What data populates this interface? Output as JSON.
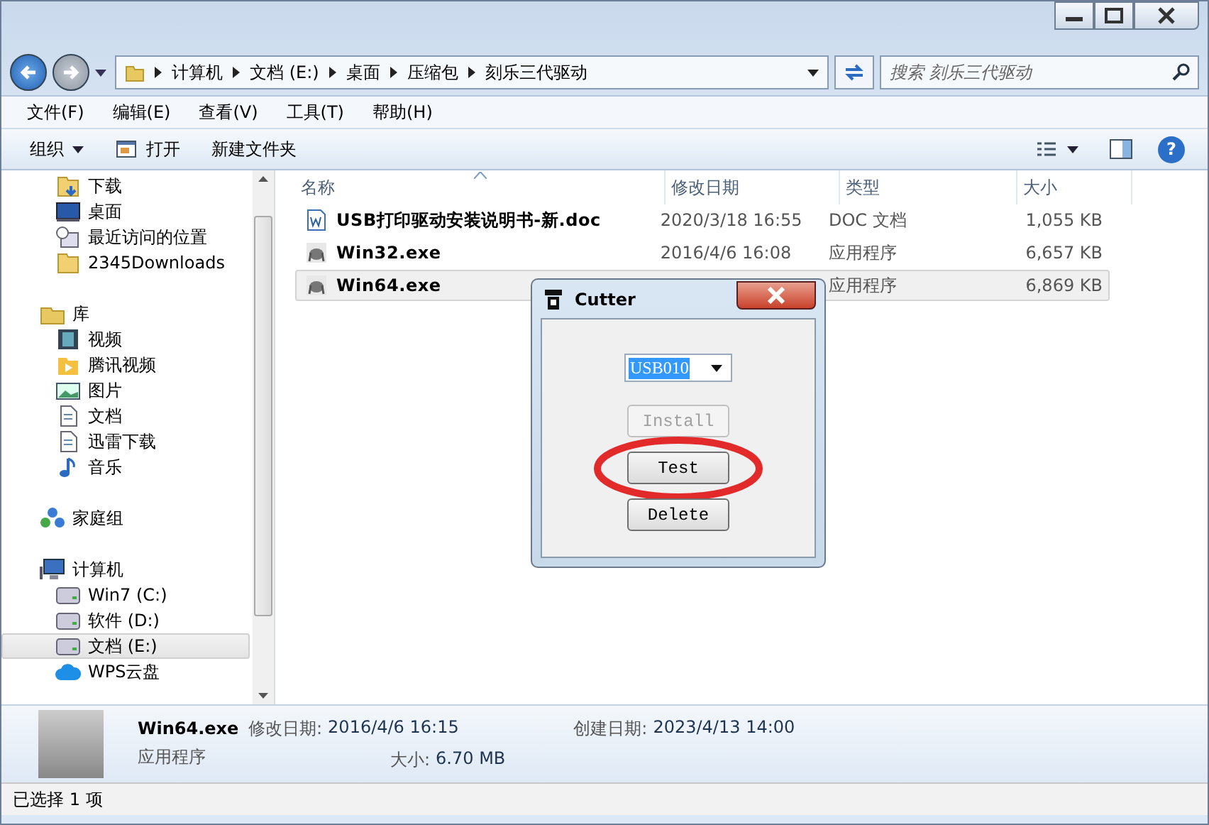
{
  "address_bar": {
    "crumbs": [
      "计算机",
      "文档 (E:)",
      "桌面",
      "压缩包",
      "刻乐三代驱动"
    ]
  },
  "search": {
    "placeholder": "搜索 刻乐三代驱动"
  },
  "menu_bar": [
    "文件(F)",
    "编辑(E)",
    "查看(V)",
    "工具(T)",
    "帮助(H)"
  ],
  "help_button": {
    "label": "?"
  },
  "toolbar": [
    {
      "label": "组织",
      "kind": "dropdown"
    },
    {
      "label": "打开",
      "kind": "open"
    },
    {
      "label": "新建文件夹",
      "kind": "plain"
    }
  ],
  "nav_pane": {
    "sections": [
      {
        "kind": "favorites",
        "children": [
          {
            "label": "下载",
            "kind": "download",
            "selected": false
          },
          {
            "label": "桌面",
            "kind": "desktop",
            "selected": false
          },
          {
            "label": "最近访问的位置",
            "kind": "recent",
            "selected": false
          },
          {
            "label": "2345Downloads",
            "kind": "folder",
            "selected": false
          }
        ]
      },
      {
        "label": "库",
        "kind": "library",
        "children": [
          {
            "label": "视频",
            "kind": "video",
            "selected": false
          },
          {
            "label": "腾讯视频",
            "kind": "player",
            "selected": false
          },
          {
            "label": "图片",
            "kind": "picture",
            "selected": false
          },
          {
            "label": "文档",
            "kind": "doc",
            "selected": false
          },
          {
            "label": "迅雷下载",
            "kind": "doc",
            "selected": false
          },
          {
            "label": "音乐",
            "kind": "music",
            "selected": false
          }
        ]
      },
      {
        "label": "家庭组",
        "kind": "homegroup"
      },
      {
        "label": "计算机",
        "kind": "computer",
        "children": [
          {
            "label": "Win7 (C:)",
            "kind": "drive",
            "selected": false
          },
          {
            "label": "软件 (D:)",
            "kind": "drive",
            "selected": false
          },
          {
            "label": "文档 (E:)",
            "kind": "drive",
            "selected": true
          },
          {
            "label": "WPS云盘",
            "kind": "cloud",
            "selected": false
          }
        ]
      }
    ]
  },
  "file_list": {
    "columns": [
      {
        "label": "名称",
        "sorted": true
      },
      {
        "label": "修改日期",
        "sorted": false
      },
      {
        "label": "类型",
        "sorted": false
      },
      {
        "label": "大小",
        "sorted": false
      }
    ],
    "rows": [
      {
        "name": "USB打印驱动安装说明书-新.doc",
        "kind": "doc",
        "modified": "2020/3/18 16:55",
        "type": "DOC 文档",
        "size": "1,055 KB",
        "selected": false
      },
      {
        "name": "Win32.exe",
        "kind": "exe",
        "modified": "2016/4/6 16:08",
        "type": "应用程序",
        "size": "6,657 KB",
        "selected": false
      },
      {
        "name": "Win64.exe",
        "kind": "exe",
        "modified": null,
        "type": "应用程序",
        "size": "6,869 KB",
        "selected": true
      }
    ]
  },
  "dialog": {
    "title": "Cutter",
    "port": {
      "value": "USB010"
    },
    "buttons": [
      {
        "label": "Install",
        "disabled": true,
        "circled": false
      },
      {
        "label": "Test",
        "disabled": false,
        "circled": true
      },
      {
        "label": "Delete",
        "disabled": false,
        "circled": false
      }
    ]
  },
  "details_pane": {
    "name": "Win64.exe",
    "type": "应用程序",
    "fields": [
      {
        "label": "修改日期:",
        "value": "2016/4/6 16:15"
      },
      {
        "label": "大小:",
        "value": "6.70 MB"
      },
      {
        "label": "创建日期:",
        "value": "2023/4/13 14:00"
      }
    ]
  },
  "status_bar": {
    "text": "已选择 1 项"
  }
}
